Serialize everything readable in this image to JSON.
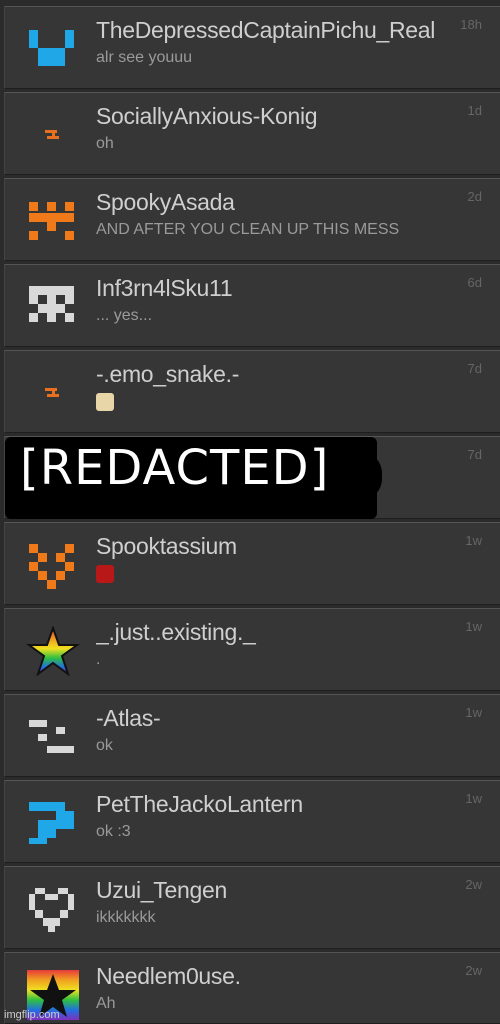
{
  "conversations": [
    {
      "name": "TheDepressedCaptainPichu_Real",
      "preview": "alr see youuu",
      "time": "18h",
      "avatar": "blue-pixel-avatar",
      "color": "#1fa7e8"
    },
    {
      "name": "SociallyAnxious-Konig",
      "preview": "oh",
      "time": "1d",
      "avatar": "orange-lightning-avatar",
      "color": "#e8701f"
    },
    {
      "name": "SpookyAsada",
      "preview": "AND AFTER YOU CLEAN UP THIS MESS",
      "time": "2d",
      "avatar": "orange-pixel-avatar",
      "color": "#f07a1a"
    },
    {
      "name": "Inf3rn4lSku11",
      "preview": "... yes...",
      "time": "6d",
      "avatar": "white-pixel-avatar",
      "color": "#d8d8d8"
    },
    {
      "name": "-.emo_snake.-",
      "preview": "",
      "time": "7d",
      "avatar": "orange-lightning-avatar",
      "color": "#e8701f",
      "emoji": "cat-emoji"
    },
    {
      "name": "[REDACTED]",
      "preview": "",
      "time": "7d",
      "avatar": "redacted",
      "color": "#000000"
    },
    {
      "name": "Spooktassium",
      "preview": "",
      "time": "1w",
      "avatar": "orange-heart-pixel-avatar",
      "color": "#f07a1a",
      "emoji": "red-arrow-emoji"
    },
    {
      "name": "_.just..existing._",
      "preview": ".",
      "time": "1w",
      "avatar": "rainbow-star-avatar",
      "color": "#e63b3b"
    },
    {
      "name": "-Atlas-",
      "preview": "ok",
      "time": "1w",
      "avatar": "white-face-pixel-avatar",
      "color": "#d8d8d8"
    },
    {
      "name": "PetTheJackoLantern",
      "preview": "ok :3",
      "time": "1w",
      "avatar": "blue-pixel-avatar",
      "color": "#1fa7e8"
    },
    {
      "name": "Uzui_Tengen",
      "preview": "ikkkkkkk",
      "time": "2w",
      "avatar": "white-heart-pixel-avatar",
      "color": "#d8d8d8"
    },
    {
      "name": "Needlem0use.",
      "preview": "Ah",
      "time": "2w",
      "avatar": "rainbow-star-avatar",
      "color": "#e63b3b"
    }
  ],
  "redacted_label": "[REDACTED]",
  "watermark": "imgflip.com"
}
